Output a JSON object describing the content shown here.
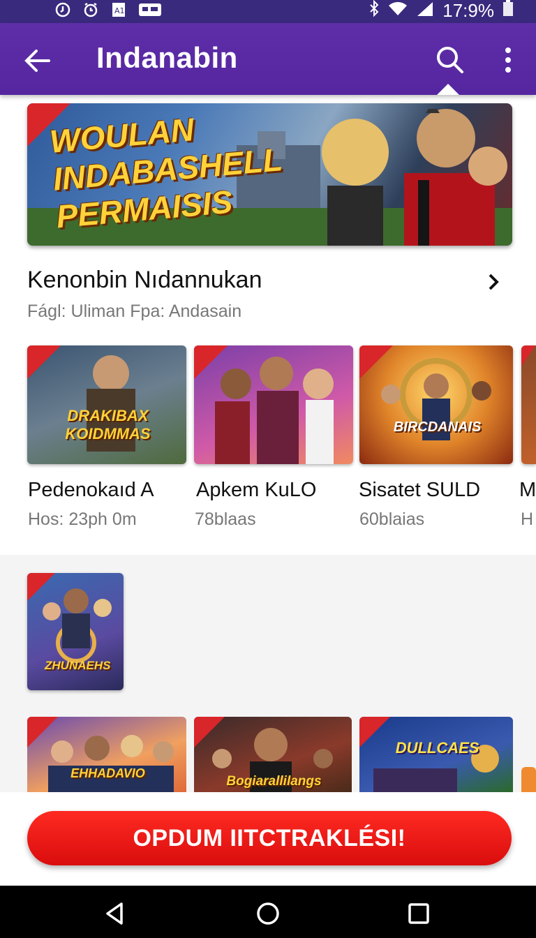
{
  "status_bar": {
    "battery_text": "17:9%",
    "icons": [
      "clock-icon",
      "alarm-icon",
      "sim-icon",
      "notification-icon",
      "bluetooth-icon",
      "wifi-icon",
      "signal-icon",
      "battery-icon"
    ]
  },
  "app_bar": {
    "title": "Indanabin",
    "back_icon": "back-arrow-icon",
    "search_icon": "search-icon",
    "menu_icon": "more-vert-icon"
  },
  "banner": {
    "text": "WOULAN INDABASHELL PERMAISIS"
  },
  "section": {
    "title": "Kenonbin Nıdannukan",
    "subtitle": "Fágl:  Uliman  Fpa:  Andasain"
  },
  "games": [
    {
      "art_text": "DRAKIBAX KOIDMMAS",
      "title": "Pedenokaıd A",
      "subtitle": "Hos: 23ph 0m"
    },
    {
      "art_text": "",
      "title": "Apkem KuLO",
      "subtitle": "78blaas"
    },
    {
      "art_text": "BIRCDANAIS",
      "title": "Sisatet SULD",
      "subtitle": "60blaias"
    },
    {
      "art_text": "",
      "title": "M",
      "subtitle": "H"
    }
  ],
  "featured_small": {
    "art_text": "ZHUNAEHS"
  },
  "row3": [
    {
      "art_text": "EHHADAVIO"
    },
    {
      "art_text": "Bogiarallilangs"
    },
    {
      "art_text": "DULLCAES"
    },
    {
      "art_text": ""
    }
  ],
  "cta": {
    "label": "OPDUM IITCTRAKLÉSI!"
  },
  "colors": {
    "app_bar": "#5e2ea8",
    "status_bar": "#3a2a7e",
    "cta": "#ff1f1f",
    "accent_gold": "#ffd23a"
  }
}
